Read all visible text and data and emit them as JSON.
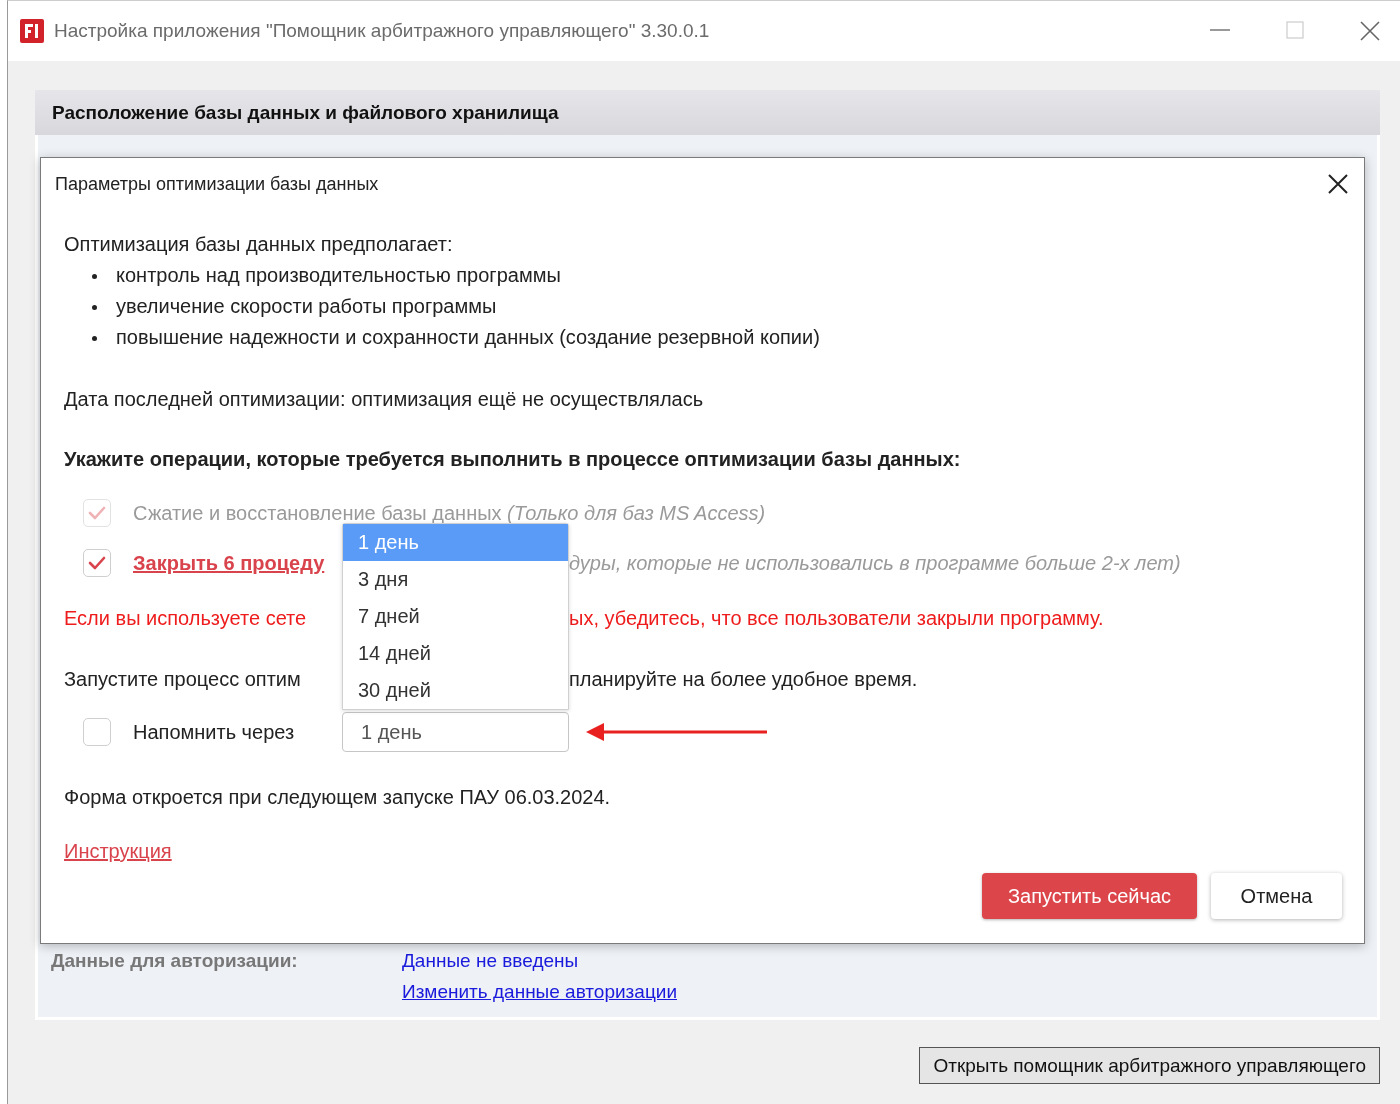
{
  "window": {
    "title": "Настройка приложения \"Помощник арбитражного управляющего\" 3.30.0.1"
  },
  "section": {
    "title": "Расположение базы данных и файлового хранилища"
  },
  "auth": {
    "label": "Данные для авторизации:",
    "value": "Данные не введены",
    "link": "Изменить данные авторизации"
  },
  "open_button": "Открыть помощник арбитражного управляющего",
  "dialog": {
    "title": "Параметры оптимизации базы данных",
    "intro": "Оптимизация базы данных предполагает:",
    "bullets": [
      "контроль над производительностью программы",
      "увеличение скорости работы программы",
      "повышение надежности и сохранности данных (создание резервной копии)"
    ],
    "last_date": "Дата последней оптимизации: оптимизация ещё не осуществлялась",
    "operations_heading": "Укажите операции, которые требуется выполнить в процессе оптимизации базы данных:",
    "operations": [
      {
        "kind": "plain",
        "label": "Сжатие и восстановление базы данных",
        "note": "(Только для баз MS Access)",
        "checked": true,
        "disabled": true
      },
      {
        "kind": "link",
        "label": "Закрыть 6 процеду",
        "note": "дуры, которые не использовались в программе больше 2-х лет)",
        "checked": true,
        "disabled": false
      }
    ],
    "warning": [
      "Если вы используете сете",
      "ых, убедитесь, что все пользователи закрыли программу."
    ],
    "hint": [
      "Запустите процесс оптим",
      "планируйте на более удобное время."
    ],
    "remind": {
      "label": "Напомнить через",
      "checked": false,
      "value": "1 день",
      "options": [
        {
          "label": "1 день",
          "selected": true
        },
        {
          "label": "3 дня",
          "selected": false
        },
        {
          "label": "7 дней",
          "selected": false
        },
        {
          "label": "14 дней",
          "selected": false
        },
        {
          "label": "30 дней",
          "selected": false
        }
      ]
    },
    "next_open": "Форма откроется при следующем запуске ПАУ 06.03.2024.",
    "instruction_link": "Инструкция",
    "buttons": [
      {
        "kind": "primary",
        "label": "Запустить сейчас"
      },
      {
        "kind": "secondary",
        "label": "Отмена"
      }
    ]
  }
}
